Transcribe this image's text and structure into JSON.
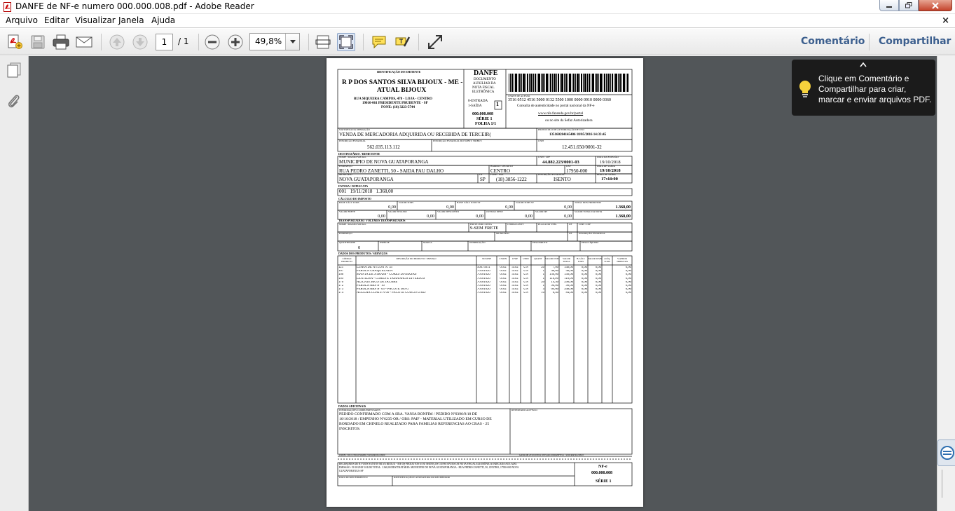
{
  "window": {
    "title": "DANFE de NF-e numero 000.000.008.pdf - Adobe Reader"
  },
  "menu": {
    "items": [
      "Arquivo",
      "Editar",
      "Visualizar",
      "Janela",
      "Ajuda"
    ],
    "close": "×"
  },
  "toolbar": {
    "page_current": "1",
    "page_total": "/ 1",
    "zoom": "49,8%",
    "comment": "Comentário",
    "share": "Compartilhar"
  },
  "tooltip": {
    "text": "Clique em Comentário e Compartilhar para criar, marcar e enviar arquivos PDF."
  },
  "icons": {
    "app": "pdf-icon",
    "create": "create-pdf-icon",
    "save": "save-icon",
    "print": "print-icon",
    "mail": "mail-icon",
    "up": "prev-page-icon",
    "down": "next-page-icon",
    "zoomout": "zoom-out-icon",
    "zoomin": "zoom-in-icon",
    "fitpage": "fit-page-icon",
    "fitwidth": "fit-width-icon",
    "comment": "comment-icon",
    "highlight": "highlight-icon",
    "expand": "full-screen-icon",
    "pages": "pages-icon",
    "attach": "attachment-icon",
    "bulb": "lightbulb-icon"
  },
  "doc": {
    "emit_hdr": "IDENTIFICAÇÃO DO EMITENTE",
    "emit_name1": "R P DOS SANTOS SILVA BIJOUX - ME -",
    "emit_name2": "ATUAL BIJOUX",
    "emit_addr1": "RUA SIQUEIRA CAMPOS, 478 - LOJA - CENTRO",
    "emit_addr2": "19010-061 PRESIDENTE PRUDENTE - SP",
    "emit_phone": "FONE: (18) 3223-5744",
    "danfe": "DANFE",
    "danfe_sub1": "DOCUMENTO",
    "danfe_sub2": "AUXILIAR DA",
    "danfe_sub3": "NOTA FISCAL",
    "danfe_sub4": "ELETRÔNICA",
    "entrada": "0-ENTRADA",
    "saida": "1-SAÍDA",
    "tipo": "1",
    "numero": "000.000.008",
    "serie": "SÉRIE 1",
    "folha": "FOLHA 1/1",
    "chave_hdr": "CHAVE DE ACESSO",
    "chave": "3516 0512 4516 5000 0132 5500 1000 0000 0910 0000 0360",
    "consulta1": "Consulta de autenticidade no portal nacional da NF-e",
    "consulta2": "www.nfe.fazenda.gov.br/portal",
    "consulta3": "ou no site da Sefaz Autorizadora",
    "natop_hdr": "NATUREZA DA OPERAÇÃO",
    "natop": "VENDA DE MERCADORIA ADQUIRIDA OU RECEBIDA DE TERCEIR(",
    "prot_hdr": "PROTOCOLO DE AUTORIZAÇÃO DE USO",
    "prot": "135160284145406 18/05/2016 14:33:45",
    "ie_hdr": "INSCRIÇÃO ESTADUAL",
    "ie": "562.035.113.112",
    "iest_hdr": "INSCRIÇÃO ESTADUAL DO SUBST. TRIBUT.",
    "cnpj_hdr": "CNPJ",
    "cnpj": "12.451.650/0001-32",
    "dest_hdr": "DESTINATÁRIO / REMETENTE",
    "dnome_hdr": "NOME / RAZÃO SOCIAL",
    "dnome": "MUNICIPIO DE NOVA GUATAPORANGA",
    "dcnpj_hdr": "CNPJ / CPF",
    "dcnpj": "44.882.223/0001-03",
    "demi_hdr": "DATA DA EMISSÃO",
    "demi": "19/10/2018",
    "dend_hdr": "ENDEREÇO",
    "dend": "RUA PEDRO ZANETTI, 50 - SAIDA PAU DALHO",
    "dbai_hdr": "BAIRRO / DISTRITO",
    "dbai": "CENTRO",
    "dcep_hdr": "CEP",
    "dcep": "17950-000",
    "dsai_hdr": "DATA DE SAÍDA",
    "dsai": "19/10/2018",
    "dmun_hdr": "MUNICÍPIO",
    "dmun": "NOVA GUATAPORANGA",
    "duf_hdr": "UF",
    "duf": "SP",
    "dfone_hdr": "FONE / FAX",
    "dfone": "(18) 3856-1222",
    "die_hdr": "INSCRIÇÃO ESTADUAL",
    "die": "ISENTO",
    "dhora_hdr": "HORA DE SAÍDA",
    "dhora": "17:44:00",
    "fat_hdr": "FATURA / DUPLICATA",
    "fat": "001   19/11/2018   1.368,00",
    "imp_hdr": "CÁLCULO DO IMPOSTO",
    "imp_r1": [
      [
        "BASE CÁLC ICMS",
        "0,00"
      ],
      [
        "VALOR ICMS",
        "0,00"
      ],
      [
        "BASE CÁLC ICMS ST",
        "0,00"
      ],
      [
        "VALOR ICMS ST",
        "0,00"
      ],
      [
        "TOTAL DOS PRODUTOS",
        "1.368,00"
      ]
    ],
    "imp_r2": [
      [
        "VALOR FRETE",
        "0,00"
      ],
      [
        "VALOR SEGURO",
        "0,00"
      ],
      [
        "VALOR DESCONTO",
        "0,00"
      ],
      [
        "OUTRAS DESP.",
        "0,00"
      ],
      [
        "VALOR IPI",
        "0,00"
      ],
      [
        "VALOR TOTAL DA NOTA",
        "1.368,00"
      ]
    ],
    "transp_hdr": "TRANSPORTADOR / VOLUMES TRANSPORTADOS",
    "t_r1": [
      "NOME / RAZÃO SOCIAL",
      "FRETE POR CONTA",
      "CÓDIGO ANTT",
      "PLACA DO VEÍC.",
      "UF",
      "CNPJ / CPF"
    ],
    "t_frete": "9-SEM FRETE",
    "t_r2": [
      "ENDEREÇO",
      "MUNICÍPIO",
      "UF",
      "INSCRIÇÃO ESTADUAL"
    ],
    "t_r3": [
      "QUANTIDADE",
      "ESPÉCIE",
      "MARCA",
      "NUMERAÇÃO",
      "PESO BRUTO",
      "PESO LÍQUIDO"
    ],
    "t_qtd": "0",
    "prod_hdr": "DADOS DOS PRODUTOS / SERVIÇOS",
    "prod_cols": [
      "CÓDIGO PRODUTO",
      "DESCRIÇÃO DO PRODUTO / SERVIÇO",
      "NCM/SH",
      "CSOSN",
      "CFOP",
      "UNID",
      "QUANT",
      "VALOR UNIT",
      "VALOR TOTAL",
      "B.CÁLC ICMS",
      "VALOR ICMS",
      "ALÍQ. ICMS",
      "V.APROX TRIBUTOS"
    ],
    "prod_rows": [
      [
        "121",
        "LINHA DE NYLON  N. 35",
        "56075011",
        "0102",
        "5102",
        "UN",
        "20",
        "7,00",
        "140,00",
        "0,00",
        "0,00",
        "",
        "0,00"
      ],
      [
        "167",
        "PEROLA CRAQUELADA",
        "70181020",
        "0102",
        "5102",
        "UN",
        "1",
        "48,00",
        "48,00",
        "0,00",
        "0,00",
        "",
        "0,00"
      ],
      [
        "168",
        "MANTA DE STRASS - CORES DIVERSAS",
        "70181020",
        "0102",
        "5102",
        "UN",
        "1",
        "150,00",
        "150,00",
        "0,00",
        "0,00",
        "",
        "0,00"
      ],
      [
        "169",
        "LENTILHA - CORES E TAMANHOS DIVERSOS",
        "70181020",
        "0102",
        "5102",
        "UN",
        "1",
        "118,00",
        "118,00",
        "0,00",
        "0,00",
        "",
        "0,00"
      ],
      [
        "170",
        "ALICATE BICO DE JACARE",
        "70181020",
        "0102",
        "5102",
        "UN",
        "20",
        "19,50",
        "390,00",
        "0,00",
        "0,00",
        "",
        "0,00"
      ],
      [
        "172",
        "PEROLA ABS Nº 10",
        "70181020",
        "0102",
        "5102",
        "UN",
        "1",
        "90,00",
        "90,00",
        "0,00",
        "0,00",
        "",
        "0,00"
      ],
      [
        "173",
        "PEROLA ABS Nº 05 - PACOTE 500 G",
        "70181020",
        "0102",
        "5102",
        "UN",
        "5",
        "69,60",
        "348,00",
        "0,00",
        "0,00",
        "",
        "0,00"
      ],
      [
        "174",
        "AGULHA COATS Nº06 - PACOTE COM 20 UNID",
        "70181020",
        "0102",
        "5102",
        "UN",
        "10",
        "8,40",
        "84,00",
        "0,00",
        "0,00",
        "",
        "0,00"
      ]
    ],
    "adic_hdr": "DADOS ADICIONAIS",
    "infc_hdr": "INFORMAÇÕES COMPLEMENTARES",
    "infc1": "PEDIDO CONFIRMADO  COM A SRA. VANIA BONFIM / PEDIDO Nº0396/9/18 DE",
    "infc2": "16/10/2018 / EMPENHO Nº6235-OR / OBS: PAIF - MATERIAL UTILIZADO EM CURSO DE",
    "infc3": "BORDADO EM CHINELO REALIZADO PARA FAMILIAS REFERENCIAS AO CRAS - 25",
    "infc4": "INSCRITOS.",
    "fisco_hdr": "RESERVADO AO FISCO",
    "foot_left": "UniNFe 7.0P e UNICO Sistema | www.unicofe.com.br",
    "foot_right": "Gerado em 23/10/2018 às 10:05 pelo UniDANFE 9.1 - www.unicofe.com.br",
    "rec_text1": "RECEBEMOS DE R P DOS SANTOS SILVA BIJOUX - ME OS PRODUTOS E/OU SERVIÇOS CONSTANTES DA NOTA FISCAL ELETRÔNICA INDICADA AO LADO.",
    "rec_text2": "EMISSÃO: 19/10/2018  VALOR TOTAL: 1.368,00  DESTINATÁRIO: MUNICIPIO DE NOVA GUATAPORANGA - RUA PEDRO ZANETTI, 50, CENTRO, 17950-000 NOVA",
    "rec_text3": "GUATAPORANGA-SP",
    "rec_data": "DATA DO RECEBIMENTO",
    "rec_ass": "IDENTIFICAÇÃO E ASSINATURA DO RECEBEDOR",
    "rec_nfe": "NF-e",
    "rec_num": "000.000.008",
    "rec_serie": "SÉRIE 1"
  }
}
